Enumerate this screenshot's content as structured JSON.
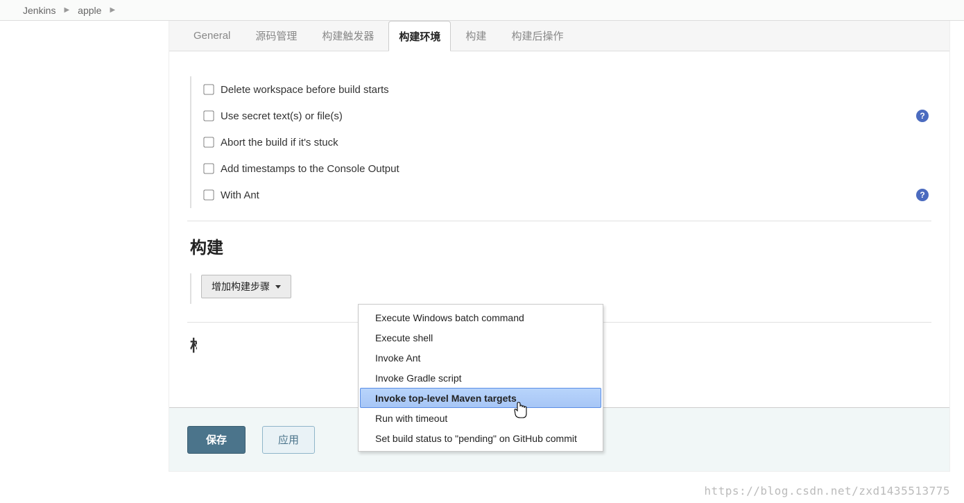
{
  "breadcrumb": {
    "items": [
      "Jenkins",
      "apple"
    ]
  },
  "tabs": [
    {
      "label": "General",
      "active": false
    },
    {
      "label": "源码管理",
      "active": false
    },
    {
      "label": "构建触发器",
      "active": false
    },
    {
      "label": "构建环境",
      "active": true
    },
    {
      "label": "构建",
      "active": false
    },
    {
      "label": "构建后操作",
      "active": false
    }
  ],
  "buildEnv": {
    "options": [
      {
        "label": "Delete workspace before build starts",
        "help": false
      },
      {
        "label": "Use secret text(s) or file(s)",
        "help": true
      },
      {
        "label": "Abort the build if it's stuck",
        "help": false
      },
      {
        "label": "Add timestamps to the Console Output",
        "help": false
      },
      {
        "label": "With Ant",
        "help": true
      }
    ]
  },
  "buildSection": {
    "heading": "构建",
    "addStepLabel": "增加构建步骤",
    "menu": [
      "Execute Windows batch command",
      "Execute shell",
      "Invoke Ant",
      "Invoke Gradle script",
      "Invoke top-level Maven targets",
      "Run with timeout",
      "Set build status to \"pending\" on GitHub commit"
    ],
    "highlightedIndex": 4
  },
  "postBuildPartialHeading": "构",
  "footer": {
    "save": "保存",
    "apply": "应用"
  },
  "helpGlyph": "?",
  "watermark": "https://blog.csdn.net/zxd1435513775"
}
